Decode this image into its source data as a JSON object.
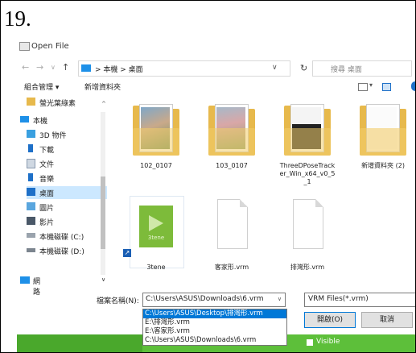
{
  "step_number": "19.",
  "dialog": {
    "title": "Open File",
    "nav": {
      "back": "←",
      "forward": "→",
      "recent": "∨",
      "up": "↑"
    },
    "address": {
      "path": "> 本機 > 桌面",
      "dropdown": "∨"
    },
    "refresh": "↻",
    "search_placeholder": "搜尋 桌面",
    "toolbar": {
      "organize": "組合管理 ▾",
      "new_folder": "新增資料夾",
      "view_dropdown": "▾"
    },
    "sidebar": {
      "scroll_up": "^",
      "scroll_down": "∨",
      "items": [
        {
          "label": "螢光葉綠素",
          "icon": "folder-icon"
        },
        {
          "label": "本機",
          "icon": "computer-icon"
        },
        {
          "label": "3D 物件",
          "icon": "cube-icon"
        },
        {
          "label": "下載",
          "icon": "download-icon"
        },
        {
          "label": "文件",
          "icon": "document-icon"
        },
        {
          "label": "音樂",
          "icon": "music-icon"
        },
        {
          "label": "桌面",
          "icon": "desktop-icon"
        },
        {
          "label": "圖片",
          "icon": "picture-icon"
        },
        {
          "label": "影片",
          "icon": "video-icon"
        },
        {
          "label": "本機磁碟 (C:)",
          "icon": "drive-icon"
        },
        {
          "label": "本機磁碟 (D:)",
          "icon": "drive-icon"
        }
      ],
      "network": "網路"
    },
    "files": [
      {
        "label": "102_0107",
        "type": "folder"
      },
      {
        "label": "103_0107",
        "type": "folder"
      },
      {
        "label": "ThreeDPoseTracker_Win_x64_v0_5_1",
        "type": "folder"
      },
      {
        "label": "新增資料夾 (2)",
        "type": "folder"
      },
      {
        "label": "3tene",
        "type": "shortcut",
        "icon_text": "3tene"
      },
      {
        "label": "客家形.vrm",
        "type": "file"
      },
      {
        "label": "排灣形.vrm",
        "type": "file"
      }
    ],
    "filename_label": "檔案名稱(N):",
    "filename_value": "C:\\Users\\ASUS\\Downloads\\6.vrm",
    "filetype": "VRM Files(*.vrm)",
    "history": [
      "C:\\Users\\ASUS\\Desktop\\排灣形.vrm",
      "E:\\排灣形.vrm",
      "E:\\客家形.vrm",
      "C:\\Users\\ASUS\\Downloads\\6.vrm"
    ],
    "open_button": "開啟(O)",
    "cancel_button": "取消",
    "background_text": "Visible"
  },
  "colors": {
    "accent": "#0078d7",
    "folder": "#e7b94c",
    "green": "#5dbf3a",
    "selected_nav": "#cce8ff"
  }
}
